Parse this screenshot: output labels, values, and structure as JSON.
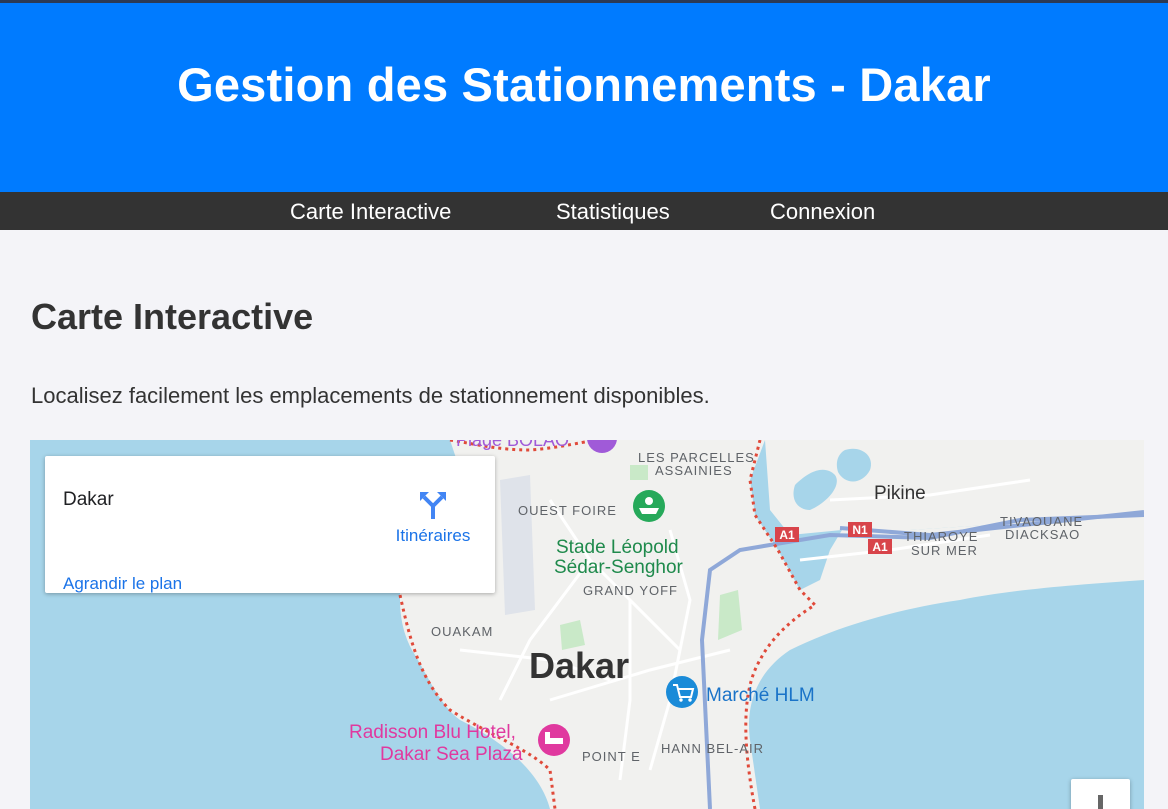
{
  "header": {
    "title": "Gestion des Stationnements - Dakar"
  },
  "nav": {
    "items": [
      "Carte Interactive",
      "Statistiques",
      "Connexion"
    ]
  },
  "main": {
    "heading": "Carte Interactive",
    "intro": "Localisez facilement les emplacements de stationnement disponibles."
  },
  "map": {
    "card": {
      "place": "Dakar",
      "directions": "Itinéraires",
      "enlarge": "Agrandir le plan"
    },
    "labels": {
      "plage": "Plage BOLAO",
      "parcelles1": "LES PARCELLES",
      "parcelles2": "ASSAINIES",
      "ouest_foire": "OUEST FOIRE",
      "stade1": "Stade Léopold",
      "stade2": "Sédar-Senghor",
      "grand_yoff": "GRAND YOFF",
      "ouakam": "OUAKAM",
      "dakar": "Dakar",
      "marche": "Marché HLM",
      "radisson1": "Radisson Blu Hotel,",
      "radisson2": "Dakar Sea Plaza",
      "point_e": "POINT E",
      "hann": "HANN BEL-AIR",
      "pikine": "Pikine",
      "thiaroye1": "THIAROYE",
      "thiaroye2": "SUR MER",
      "tivaouane1": "TIVAOUANE",
      "tivaouane2": "DIACKSAO"
    },
    "shields": {
      "a1": "A1",
      "n1": "N1"
    },
    "colors": {
      "water": "#a7d5ea",
      "land": "#f1f1ef",
      "park": "#c9e9c8",
      "border": "#e04a3a",
      "road": "#8fa8d8",
      "shield": "#d8444a",
      "poi_green": "#26a95a",
      "poi_blue": "#1a8bd8",
      "poi_pink": "#e0399f",
      "poi_purple": "#a05ad8"
    }
  }
}
